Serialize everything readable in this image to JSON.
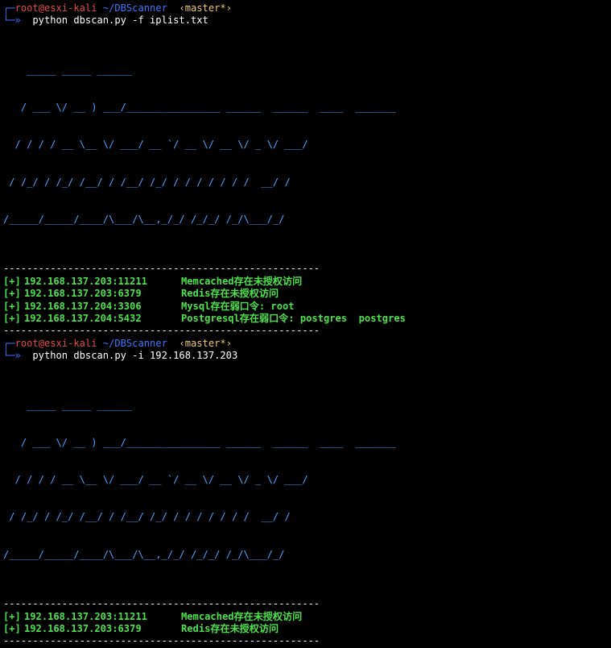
{
  "sessions": [
    {
      "prompt": {
        "user": "root",
        "at": "@",
        "host": "esxi-kali",
        "path": "~/DBScanner",
        "branch": "‹master*›",
        "arrow": "└─»",
        "corner": "┌─"
      },
      "command": "python dbscan.py -f iplist.txt",
      "banner": [
        "    _____ _____ ______",
        "   / ___ \\/ __ ) ___/________________ ______  ______  ____  _______",
        "  / / / / __ \\__ \\/ ___/ __ `/ __ \\/ __ \\/ _ \\/ ___/",
        " / /_/ / /_/ /__/ / /__/ /_/ / / / / / / /  __/ /",
        "/_____/_____/____/\\___/\\__,_/_/ /_/_/ /_/\\___/_/"
      ],
      "separator": "------------------------------------------------------",
      "results": [
        {
          "tag": "[+]",
          "host": "192.168.137.203:11211",
          "msg": "Memcached存在未授权访问"
        },
        {
          "tag": "[+]",
          "host": "192.168.137.203:6379",
          "msg": "Redis存在未授权访问"
        },
        {
          "tag": "[+]",
          "host": "192.168.137.204:3306",
          "msg": "Mysql存在弱口令: root"
        },
        {
          "tag": "[+]",
          "host": "192.168.137.204:5432",
          "msg": "Postgresql存在弱口令: postgres  postgres"
        }
      ]
    },
    {
      "prompt": {
        "user": "root",
        "at": "@",
        "host": "esxi-kali",
        "path": "~/DBScanner",
        "branch": "‹master*›",
        "arrow": "└─»",
        "corner": "┌─"
      },
      "command": "python dbscan.py -i 192.168.137.203",
      "banner": [
        "    _____ _____ ______",
        "   / ___ \\/ __ ) ___/________________ ______  ______  ____  _______",
        "  / / / / __ \\__ \\/ ___/ __ `/ __ \\/ __ \\/ _ \\/ ___/",
        " / /_/ / /_/ /__/ / /__/ /_/ / / / / / / /  __/ /",
        "/_____/_____/____/\\___/\\__,_/_/ /_/_/ /_/\\___/_/"
      ],
      "separator": "------------------------------------------------------",
      "results": [
        {
          "tag": "[+]",
          "host": "192.168.137.203:11211",
          "msg": "Memcached存在未授权访问"
        },
        {
          "tag": "[+]",
          "host": "192.168.137.203:6379",
          "msg": "Redis存在未授权访问"
        }
      ]
    }
  ]
}
